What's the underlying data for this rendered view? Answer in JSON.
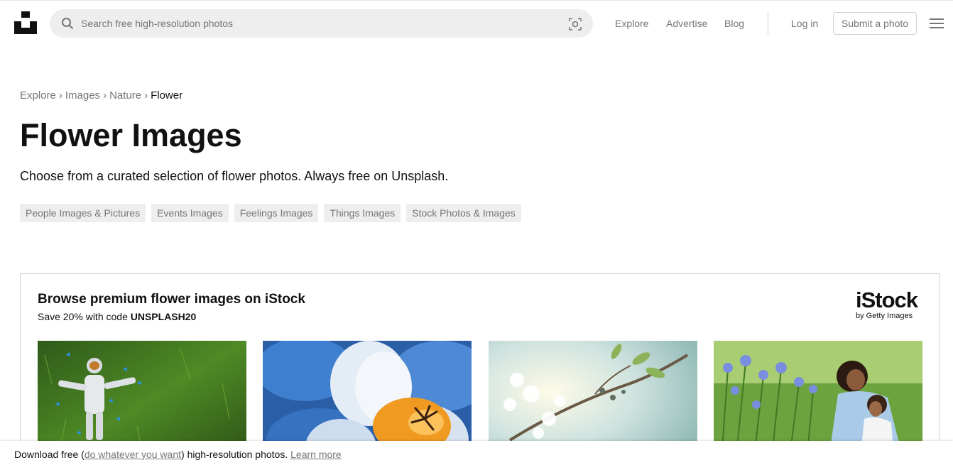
{
  "header": {
    "logo_name": "unsplash-logo",
    "search": {
      "placeholder": "Search free high-resolution photos"
    },
    "nav": {
      "explore": "Explore",
      "advertise": "Advertise",
      "blog": "Blog",
      "login": "Log in",
      "submit": "Submit a photo"
    }
  },
  "breadcrumb": {
    "items": [
      "Explore",
      "Images",
      "Nature"
    ],
    "current": "Flower",
    "separator": "›"
  },
  "page": {
    "title": "Flower Images",
    "subtitle": "Choose from a curated selection of flower photos. Always free on Unsplash."
  },
  "tags": [
    "People Images & Pictures",
    "Events Images",
    "Feelings Images",
    "Things Images",
    "Stock Photos & Images"
  ],
  "istock": {
    "title": "Browse premium flower images on iStock",
    "sub_prefix": "Save 20% with code ",
    "code": "UNSPLASH20",
    "logo_text": "iStock",
    "logo_sub": "by Getty Images",
    "images": [
      "astronaut-in-grass-with-butterflies",
      "blue-orange-flower-closeup",
      "cherry-blossom-branch",
      "mother-daughter-in-flowers"
    ]
  },
  "bottom_bar": {
    "prefix": "Download free (",
    "link1": "do whatever you want",
    "middle": ") high-resolution photos. ",
    "link2": "Learn more"
  },
  "colors": {
    "muted": "#767676",
    "text": "#111111",
    "pill_bg": "#eeeeee",
    "border": "#d1d1d1"
  }
}
